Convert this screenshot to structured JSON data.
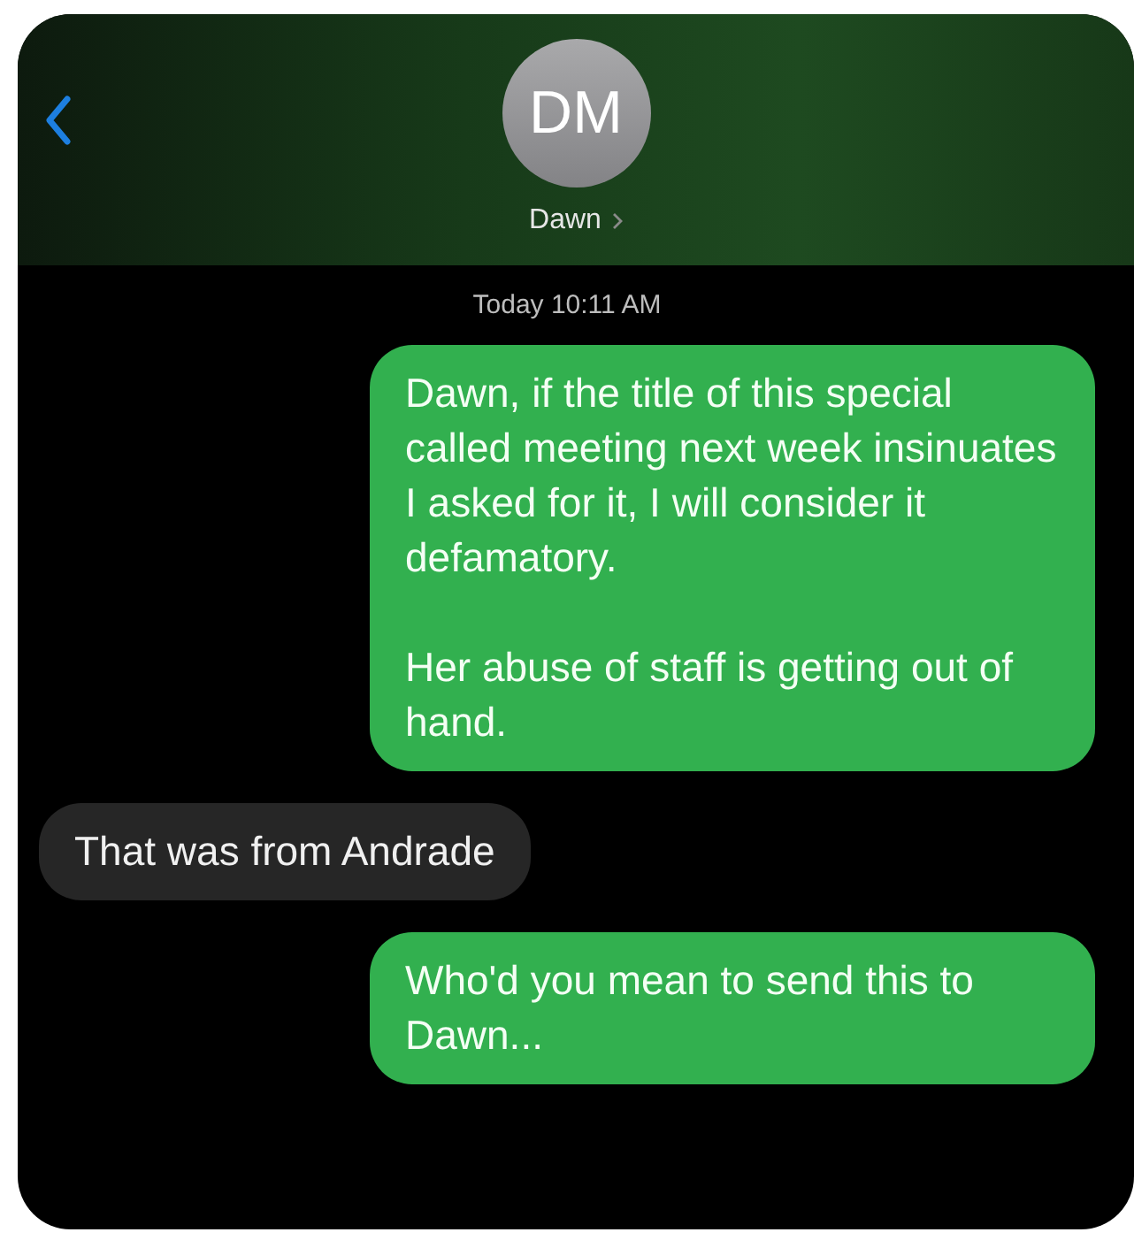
{
  "header": {
    "avatar_initials": "DM",
    "contact_name": "Dawn"
  },
  "timestamp": "Today 10:11 AM",
  "messages": [
    {
      "kind": "sent",
      "paragraphs": [
        "Dawn, if the title of this special called meeting next week insinuates I asked for it, I will consider it defamatory.",
        "Her abuse of staff is getting out of hand."
      ]
    },
    {
      "kind": "received",
      "paragraphs": [
        "That was from Andrade"
      ]
    },
    {
      "kind": "sent",
      "paragraphs": [
        "Who'd you mean to send this to Dawn..."
      ]
    }
  ]
}
